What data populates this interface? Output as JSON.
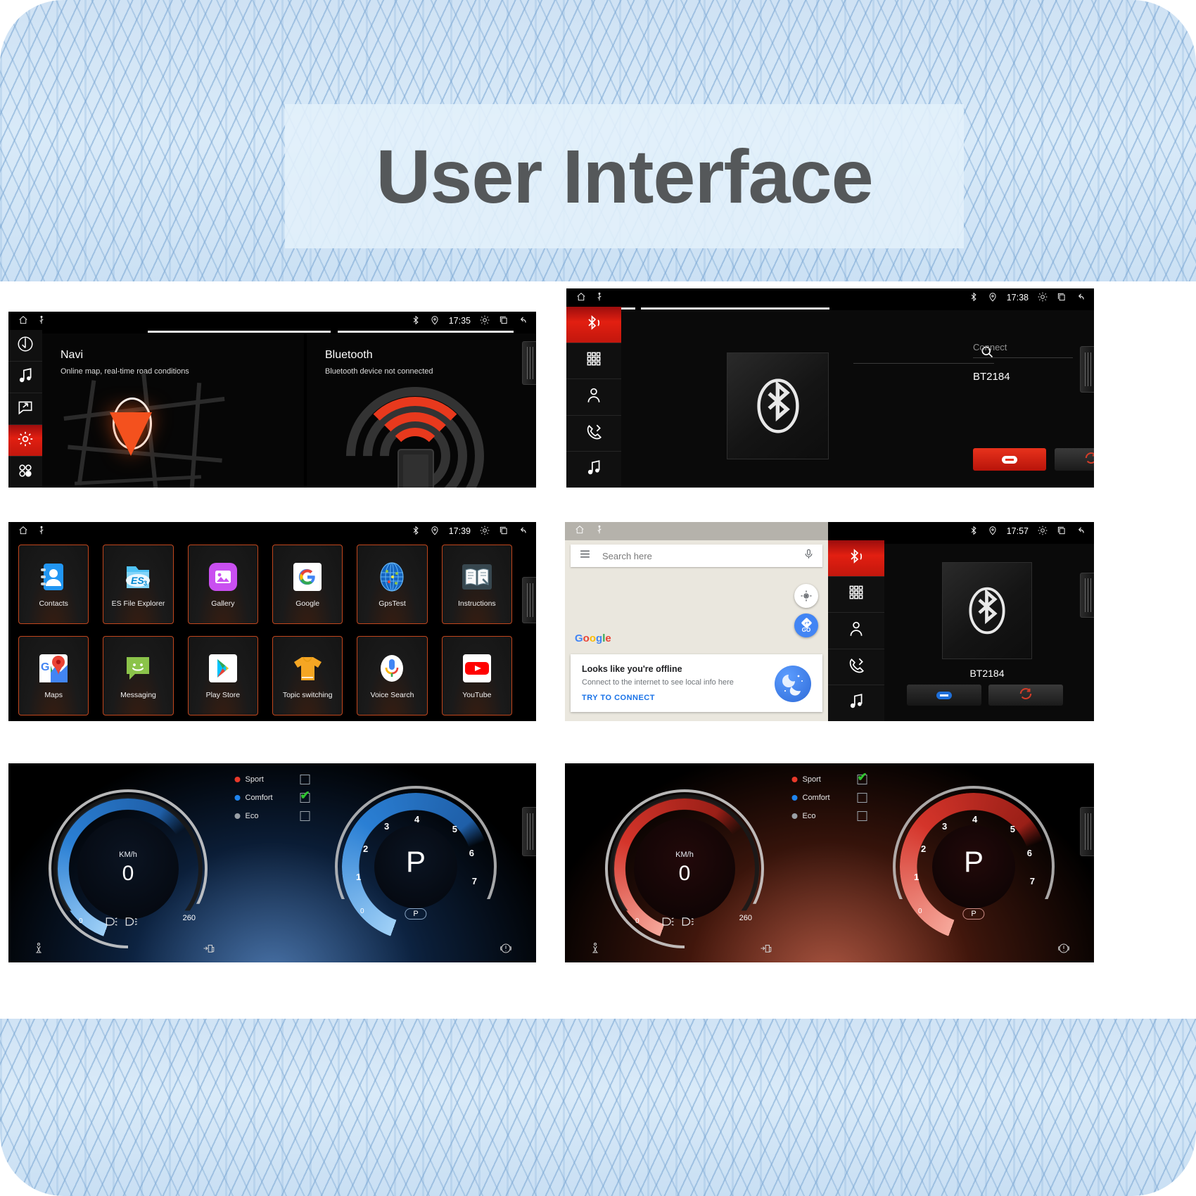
{
  "page": {
    "title": "User Interface"
  },
  "panels": {
    "home": {
      "statusbar": {
        "time": "17:35",
        "icons": [
          "home-icon",
          "usb-icon",
          "bluetooth-icon",
          "location-icon",
          "brightness-icon",
          "recents-icon",
          "back-icon"
        ]
      },
      "rail": [
        {
          "name": "navigation",
          "label": "Navi"
        },
        {
          "name": "music",
          "label": "Music"
        },
        {
          "name": "screen-mirror",
          "label": "Mirror"
        },
        {
          "name": "settings",
          "label": "Settings",
          "active": true
        },
        {
          "name": "apps",
          "label": "Apps"
        }
      ],
      "cards": [
        {
          "title": "Navi",
          "subtitle": "Online map, real-time road conditions"
        },
        {
          "title": "Bluetooth",
          "subtitle": "Bluetooth device not connected"
        }
      ]
    },
    "bluetooth_settings": {
      "statusbar": {
        "time": "17:38"
      },
      "rail": [
        {
          "name": "bluetooth",
          "active": true
        },
        {
          "name": "dialpad",
          "active": false
        },
        {
          "name": "contacts",
          "active": false
        },
        {
          "name": "call-history",
          "active": false
        },
        {
          "name": "music",
          "active": false
        }
      ],
      "search_placeholder": "",
      "connect_label": "Connect",
      "device_name": "BT2184",
      "buttons": [
        {
          "name": "disconnect-button",
          "icon": "minus-pill-icon",
          "style": "red"
        },
        {
          "name": "refresh-button",
          "icon": "refresh-icon",
          "style": "grey"
        }
      ]
    },
    "apps": {
      "statusbar": {
        "time": "17:39"
      },
      "items": [
        {
          "label": "Contacts",
          "icon": "contacts-icon"
        },
        {
          "label": "ES File Explorer",
          "icon": "es-file-explorer-icon"
        },
        {
          "label": "Gallery",
          "icon": "gallery-icon"
        },
        {
          "label": "Google",
          "icon": "google-icon"
        },
        {
          "label": "GpsTest",
          "icon": "gpstest-icon"
        },
        {
          "label": "Instructions",
          "icon": "instructions-icon"
        },
        {
          "label": "Maps",
          "icon": "maps-icon"
        },
        {
          "label": "Messaging",
          "icon": "messaging-icon"
        },
        {
          "label": "Play Store",
          "icon": "play-store-icon"
        },
        {
          "label": "Topic switching",
          "icon": "topic-switching-icon"
        },
        {
          "label": "Voice Search",
          "icon": "voice-search-icon"
        },
        {
          "label": "YouTube",
          "icon": "youtube-icon"
        }
      ]
    },
    "maps_offline": {
      "statusbar_icons": [
        "home-icon",
        "usb-icon"
      ],
      "search_placeholder": "Search here",
      "brand": "Google",
      "go_label": "GO",
      "card": {
        "title": "Looks like you're offline",
        "body": "Connect to the internet to see local info here",
        "action": "TRY TO CONNECT"
      }
    },
    "bluetooth_connected": {
      "statusbar": {
        "time": "17:57"
      },
      "device_name": "BT2184",
      "buttons": [
        {
          "name": "disconnect-button",
          "icon": "minus-pill-icon",
          "style": "red"
        },
        {
          "name": "refresh-button",
          "icon": "refresh-icon",
          "style": "grey"
        }
      ]
    },
    "dash_comfort": {
      "modes": [
        {
          "label": "Sport",
          "color": "#e8392a",
          "checked": false
        },
        {
          "label": "Comfort",
          "color": "#1f84ee",
          "checked": true
        },
        {
          "label": "Eco",
          "color": "#9aa0a6",
          "checked": false
        }
      ],
      "speed": {
        "unit": "KM/h",
        "value": "0",
        "max": "260",
        "min": "0"
      },
      "rpm": {
        "gear": "P",
        "badge": "P",
        "min": "0",
        "ticks": [
          "1",
          "2",
          "3",
          "4",
          "5",
          "6",
          "7"
        ]
      },
      "theme": "blue"
    },
    "dash_sport": {
      "modes": [
        {
          "label": "Sport",
          "color": "#e8392a",
          "checked": true
        },
        {
          "label": "Comfort",
          "color": "#1f84ee",
          "checked": false
        },
        {
          "label": "Eco",
          "color": "#9aa0a6",
          "checked": false
        }
      ],
      "speed": {
        "unit": "KM/h",
        "value": "0",
        "max": "260",
        "min": "0"
      },
      "rpm": {
        "gear": "P",
        "badge": "P",
        "min": "0",
        "ticks": [
          "1",
          "2",
          "3",
          "4",
          "5",
          "6",
          "7"
        ]
      },
      "theme": "red"
    }
  },
  "colors": {
    "accent_red": "#e21f11",
    "tile_border": "#c1461d",
    "blue_gauge": "#2a7fd4",
    "red_gauge": "#d4342a",
    "link_blue": "#1a73e8"
  }
}
